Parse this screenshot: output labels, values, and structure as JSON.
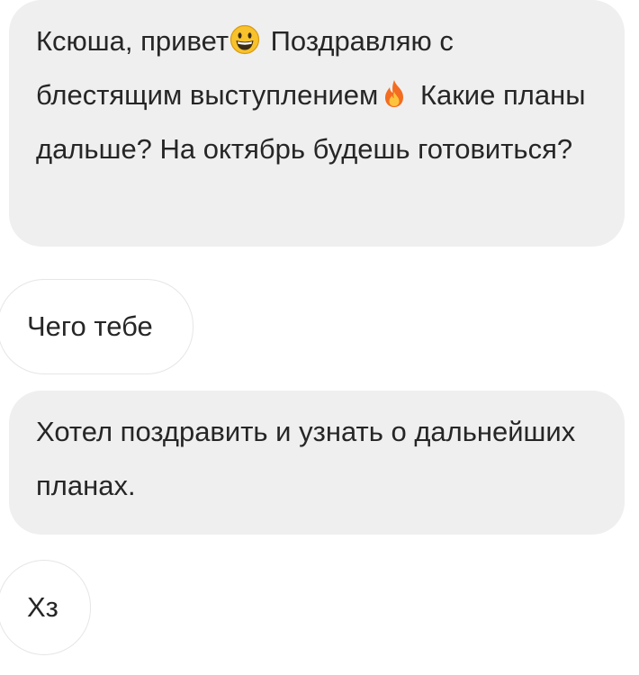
{
  "messages": [
    {
      "direction": "sent",
      "text_before": "Ксюша, привет",
      "emoji_1": "grinning-face-icon",
      "text_middle": " Поздравляю с блестящим выступлением",
      "emoji_2": "fire-icon",
      "text_after": " Какие планы дальше? На октябрь будешь готовиться?"
    },
    {
      "direction": "received",
      "text": "Чего тебе"
    },
    {
      "direction": "sent",
      "text": "Хотел поздравить и узнать о дальнейших планах."
    },
    {
      "direction": "received",
      "text": "Хз"
    }
  ],
  "colors": {
    "sent_bubble": "#efefef",
    "received_bubble": "#ffffff",
    "received_border": "#e6e6e6",
    "text": "#262626"
  }
}
